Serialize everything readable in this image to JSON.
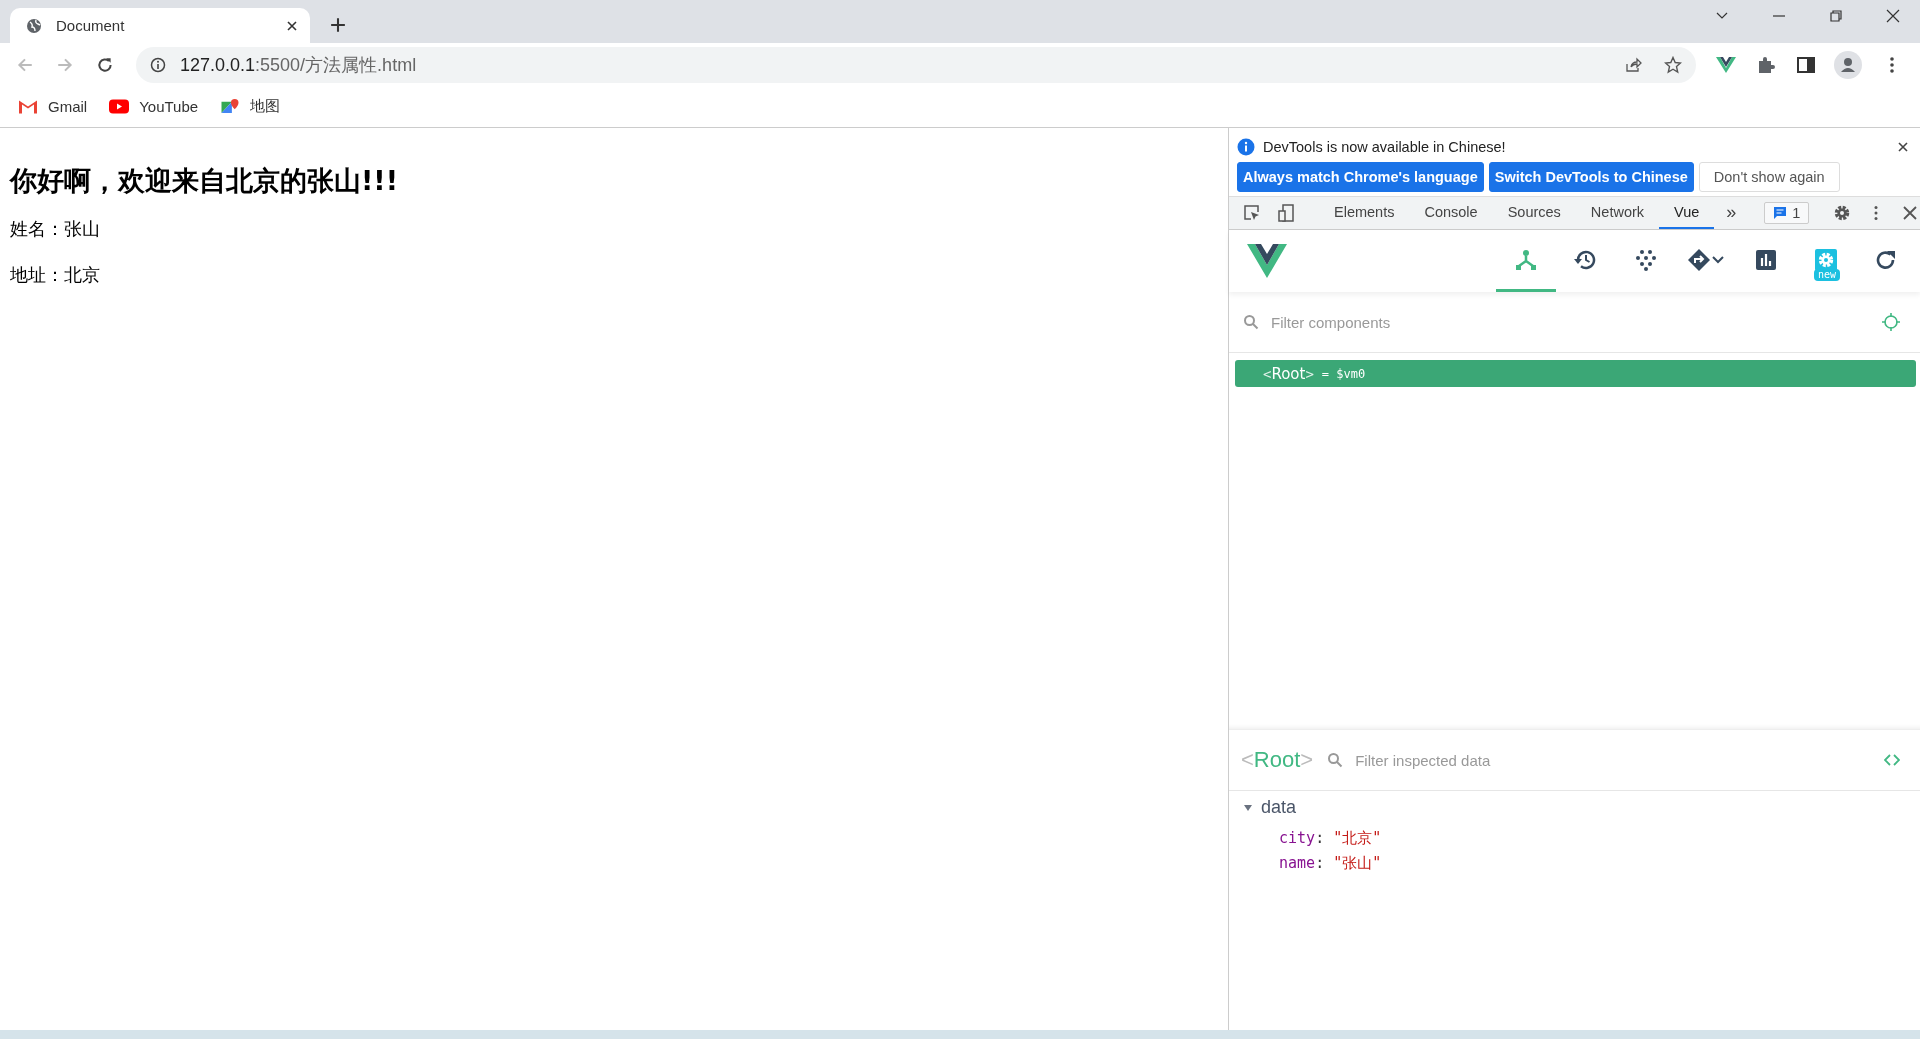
{
  "browser": {
    "tab": {
      "title": "Document"
    },
    "address": {
      "host": "127.0.0.1",
      "rest": ":5500/方法属性.html"
    },
    "bookmarks": [
      {
        "label": "Gmail",
        "kind": "gmail"
      },
      {
        "label": "YouTube",
        "kind": "youtube"
      },
      {
        "label": "地图",
        "kind": "maps"
      }
    ]
  },
  "page": {
    "heading": "你好啊，欢迎来自北京的张山!!!",
    "lines": [
      "姓名：张山",
      "地址：北京"
    ]
  },
  "devtools": {
    "notice": {
      "message": "DevTools is now available in Chinese!",
      "buttons": [
        {
          "label": "Always match Chrome's language",
          "kind": "primary"
        },
        {
          "label": "Switch DevTools to Chinese",
          "kind": "primary"
        },
        {
          "label": "Don't show again",
          "kind": "secondary"
        }
      ]
    },
    "tabs": [
      {
        "label": "Elements",
        "selected": false
      },
      {
        "label": "Console",
        "selected": false
      },
      {
        "label": "Sources",
        "selected": false
      },
      {
        "label": "Network",
        "selected": false
      },
      {
        "label": "Vue",
        "selected": true
      }
    ],
    "more": "»",
    "issues_count": "1",
    "vue": {
      "tools": [
        {
          "kind": "components",
          "selected": true
        },
        {
          "kind": "timeline",
          "selected": false
        },
        {
          "kind": "dots",
          "selected": false
        },
        {
          "kind": "router",
          "selected": false
        },
        {
          "kind": "performance",
          "selected": false
        },
        {
          "kind": "settings",
          "selected": false,
          "badge": "new"
        },
        {
          "kind": "refresh",
          "selected": false
        }
      ],
      "filter_placeholder": "Filter components",
      "tree": [
        {
          "open": "<",
          "name": "Root",
          "close": ">",
          "alias": "= $vm0",
          "selected": true
        }
      ],
      "inspector": {
        "open": "<",
        "component": "Root",
        "close": ">",
        "filter_placeholder": "Filter inspected data",
        "sections": [
          {
            "title": "data",
            "expanded": true,
            "fields": [
              {
                "key": "city",
                "sep": ":",
                "value": "\"北京\""
              },
              {
                "key": "name",
                "sep": ":",
                "value": "\"张山\""
              }
            ]
          }
        ]
      }
    }
  }
}
